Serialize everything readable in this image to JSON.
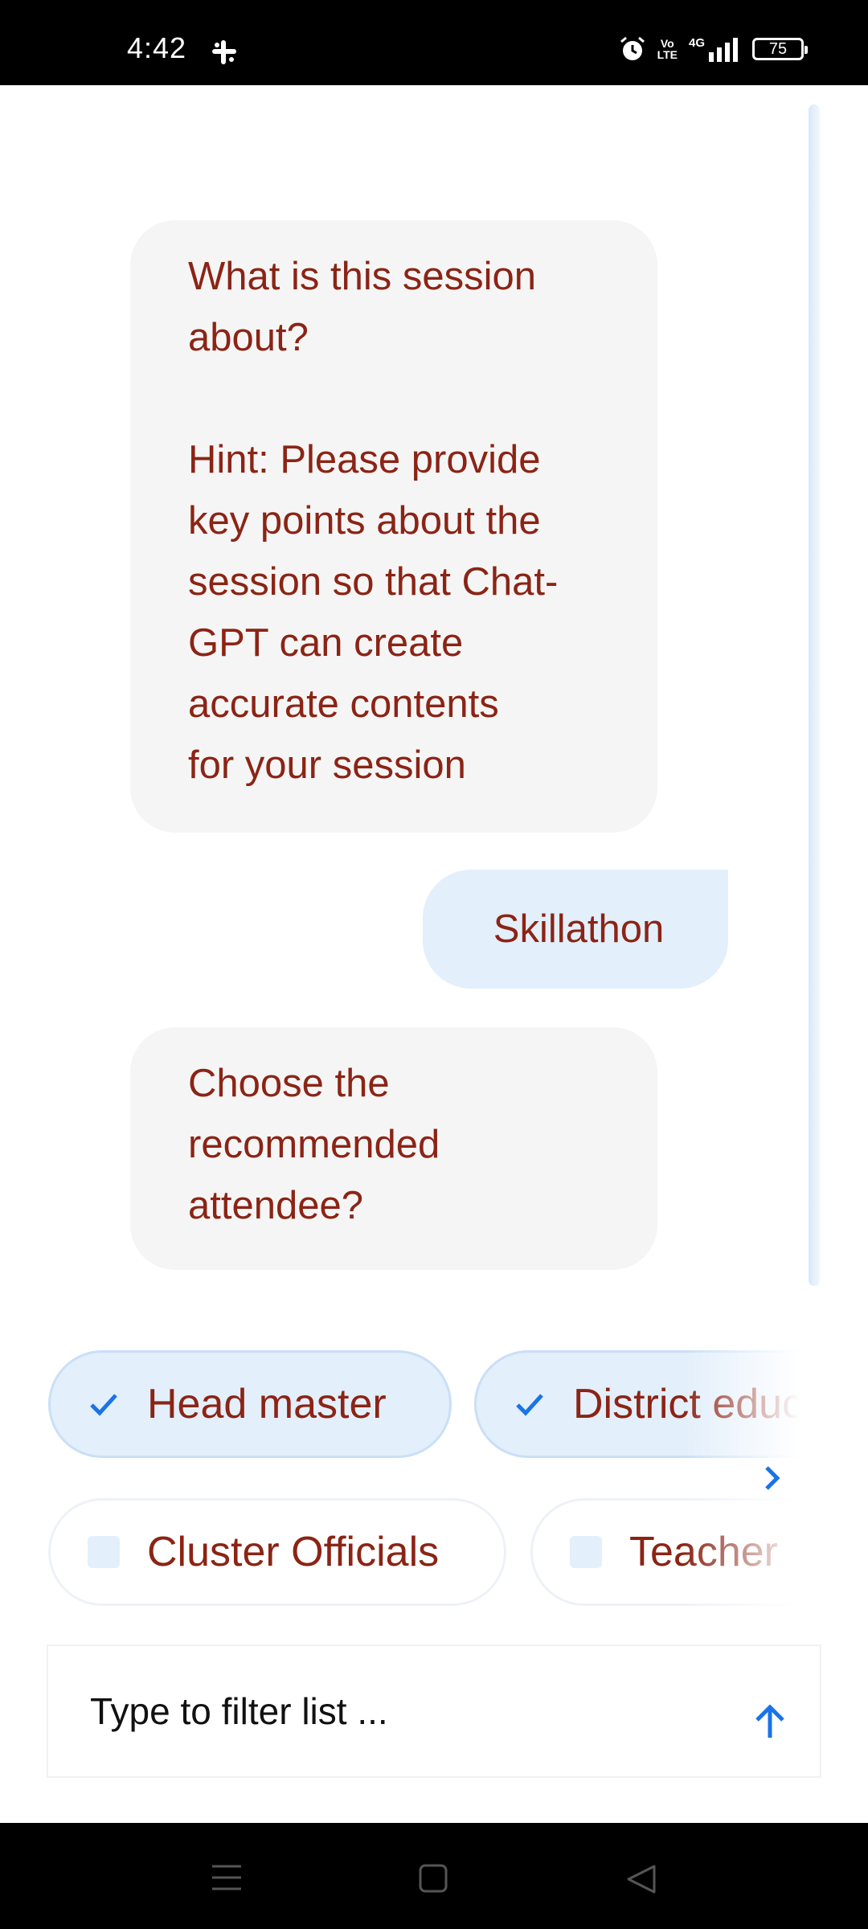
{
  "status_bar": {
    "time": "4:42",
    "network_label": "4G",
    "volte_top": "Vo",
    "volte_bottom": "LTE",
    "battery": "75",
    "icons": [
      "slack-icon",
      "alarm-icon",
      "volte-icon",
      "signal-icon",
      "battery-icon"
    ]
  },
  "chat": {
    "messages": [
      {
        "sender": "bot",
        "text": "What is this session\nabout?\n\nHint: Please provide\nkey points about the\nsession so that Chat-\nGPT can create\naccurate contents\nfor your session"
      },
      {
        "sender": "user",
        "text": "Skillathon"
      },
      {
        "sender": "bot",
        "text": "Choose the\nrecommended\nattendee?"
      }
    ]
  },
  "options": [
    {
      "label": "Head master",
      "selected": true
    },
    {
      "label": "District educ",
      "selected": true
    },
    {
      "label": "Cluster Officials",
      "selected": false
    },
    {
      "label": "Teacher",
      "selected": false
    }
  ],
  "filter": {
    "placeholder": "Type to filter list ..."
  },
  "colors": {
    "message_text": "#8b2415",
    "bot_bubble": "#f5f5f5",
    "user_bubble": "#e3effb",
    "accent": "#1a73e8"
  },
  "nav_bar": {
    "icons": [
      "menu-icon",
      "home-icon",
      "back-icon"
    ]
  }
}
